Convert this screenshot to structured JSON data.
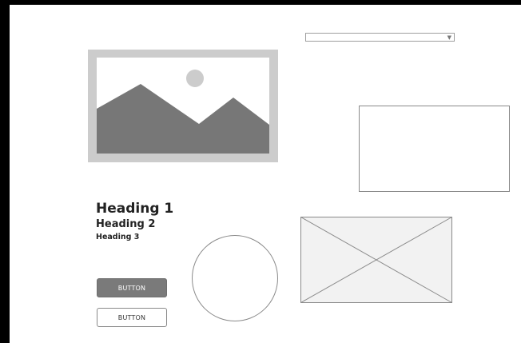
{
  "dropdown": {
    "selected": "",
    "caret_icon": "chevron-down-icon"
  },
  "image_placeholder": {
    "icon": "landscape-image-icon",
    "frame_color": "#cccccc",
    "mountain_color": "#777777",
    "sun_color": "#cccccc"
  },
  "headings": {
    "h1": "Heading 1",
    "h2": "Heading 2",
    "h3": "Heading 3"
  },
  "buttons": {
    "primary_label": "BUTTON",
    "secondary_label": "BUTTON",
    "primary_color": "#7a7a7a"
  },
  "placeholders": {
    "x_icon": "image-placeholder-x-icon",
    "x_fill": "#f2f2f2"
  }
}
